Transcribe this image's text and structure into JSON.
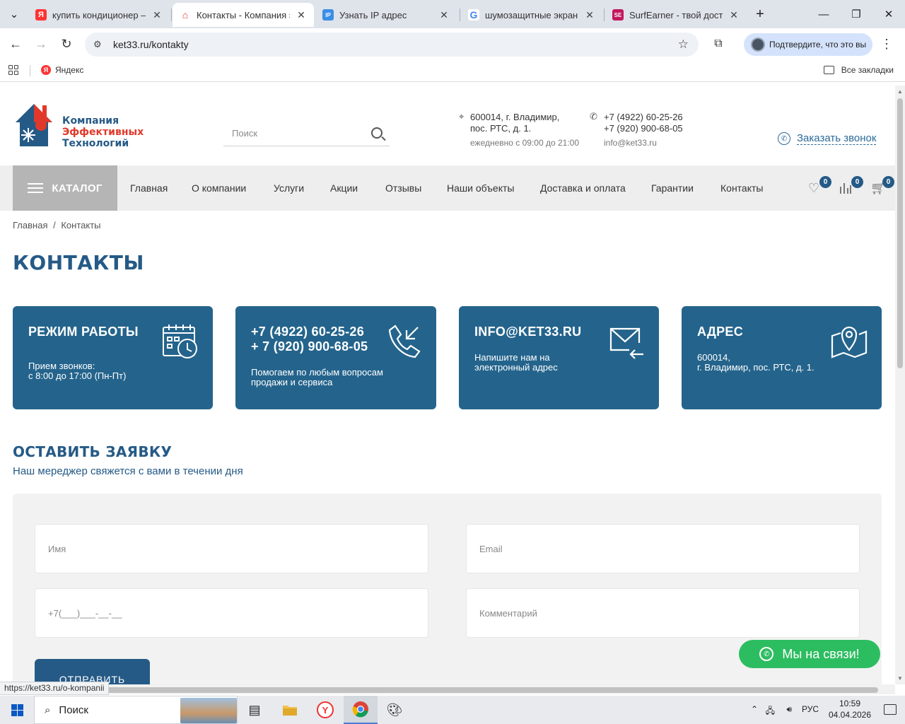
{
  "browser": {
    "tabs": [
      {
        "title": "купить кондиционер —",
        "favicon": "yandex-icon",
        "color": "#f33",
        "glyph": "Я"
      },
      {
        "title": "Контакты - Компания эф",
        "favicon": "ket33-icon",
        "color": "#e0392b",
        "glyph": "⌂",
        "active": true
      },
      {
        "title": "Узнать IP адрес",
        "favicon": "ip-icon",
        "color": "#3a8ee6",
        "glyph": "IP"
      },
      {
        "title": "шумозащитные экраны",
        "favicon": "google-icon",
        "color": "#4285f4",
        "glyph": "G"
      },
      {
        "title": "SurfEarner - твой доступ",
        "favicon": "surfearner-icon",
        "color": "#c2185b",
        "glyph": "SE"
      }
    ],
    "new_tab": "+",
    "url": "ket33.ru/kontakty",
    "profile_chip": "Подтвердите, что это вы",
    "bookmarks": {
      "yandex": "Яндекс",
      "all": "Все закладки"
    },
    "status_url": "https://ket33.ru/o-kompanii"
  },
  "header": {
    "logo_lines": [
      "Компания",
      "Эффективных",
      "Технологий"
    ],
    "search_placeholder": "Поиск",
    "address_line1": "600014, г. Владимир,",
    "address_line2": "пос. РТС, д. 1.",
    "hours": "ежедневно с 09:00 до 21:00",
    "phone1": "+7 (4922) 60-25-26",
    "phone2": "+7 (920) 900-68-05",
    "email": "info@ket33.ru",
    "callback": "Заказать звонок"
  },
  "nav": {
    "catalog": "КАТАЛОГ",
    "items": [
      "Главная",
      "О компании",
      "Услуги",
      "Акции",
      "Отзывы",
      "Наши объекты",
      "Доставка и оплата",
      "Гарантии",
      "Контакты"
    ],
    "favorites_count": "0",
    "compare_count": "0",
    "cart_count": "0"
  },
  "breadcrumb": {
    "home": "Главная",
    "sep": "/",
    "current": "Контакты"
  },
  "title": "КОНТАКТЫ",
  "cards": [
    {
      "title": "РЕЖИМ РАБОТЫ",
      "text1": "Прием звонков:",
      "text2": "с 8:00 до 17:00 (Пн-Пт)",
      "icon": "calendar-clock-icon"
    },
    {
      "title": "+7 (4922) 60-25-26",
      "title2": "+ 7 (920) 900-68-05",
      "text1": "Помогаем по любым вопросам",
      "text2": "продажи и сервиса",
      "icon": "incoming-call-icon"
    },
    {
      "title": "INFO@KET33.RU",
      "text1": "Напишите нам на",
      "text2": "электронный адрес",
      "icon": "mail-icon"
    },
    {
      "title": "АДРЕС",
      "text1": "600014,",
      "text2": "г. Владимир, пос. РТС, д. 1.",
      "icon": "map-pin-icon"
    }
  ],
  "form": {
    "title": "ОСТАВИТЬ ЗАЯВКУ",
    "subtitle": "Наш мереджер свяжется с вами в течении дня",
    "name_placeholder": "Имя",
    "email_placeholder": "Email",
    "phone_placeholder": "+7(___)___-__-__",
    "comment_placeholder": "Комментарий",
    "submit": "ОТПРАВИТЬ"
  },
  "chat": "Мы на связи!",
  "taskbar": {
    "search": "Поиск",
    "lang": "РУС",
    "time": "10:59",
    "date": "04.04.2026"
  },
  "colors": {
    "brand_blue": "#24648c",
    "brand_red": "#e0392b",
    "whatsapp_green": "#2dbd61"
  }
}
